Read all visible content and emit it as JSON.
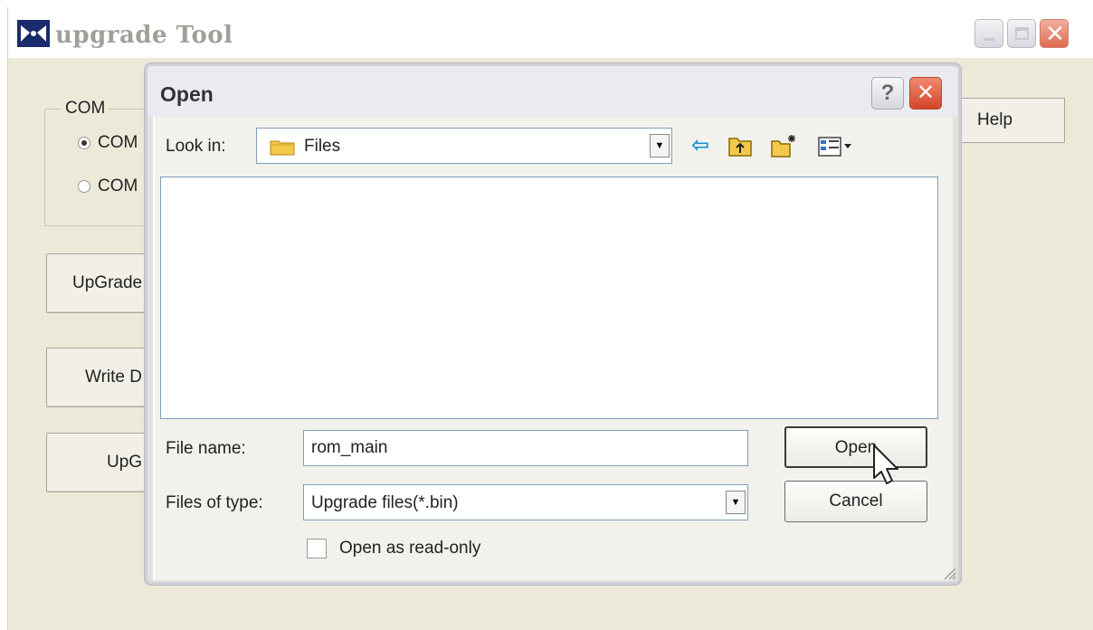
{
  "main_window": {
    "title": "upgrade Tool",
    "com_group": {
      "legend": "COM",
      "options": [
        {
          "label": "COM",
          "checked": true
        },
        {
          "label": "COM",
          "checked": false
        }
      ]
    },
    "buttons": [
      "UpGrade",
      "Write D",
      "UpG"
    ],
    "help_label": "Help"
  },
  "dialog": {
    "title": "Open",
    "help_glyph": "?",
    "close_glyph": "✕",
    "look_in_label": "Look in:",
    "look_in_value": "Files",
    "file_name_label": "File name:",
    "file_name_value": "rom_main",
    "files_of_type_label": "Files of type:",
    "files_of_type_value": "Upgrade files(*.bin)",
    "open_label": "Open",
    "cancel_label": "Cancel",
    "read_only_label": "Open as read-only",
    "read_only_checked": false
  },
  "icons": {
    "back": "back-arrow-icon",
    "up": "up-folder-icon",
    "new_folder": "new-folder-icon",
    "view": "view-menu-icon"
  },
  "colors": {
    "close_red": "#d4452a",
    "dialog_bg": "#f2f1ec",
    "input_border": "#7f9db9"
  }
}
